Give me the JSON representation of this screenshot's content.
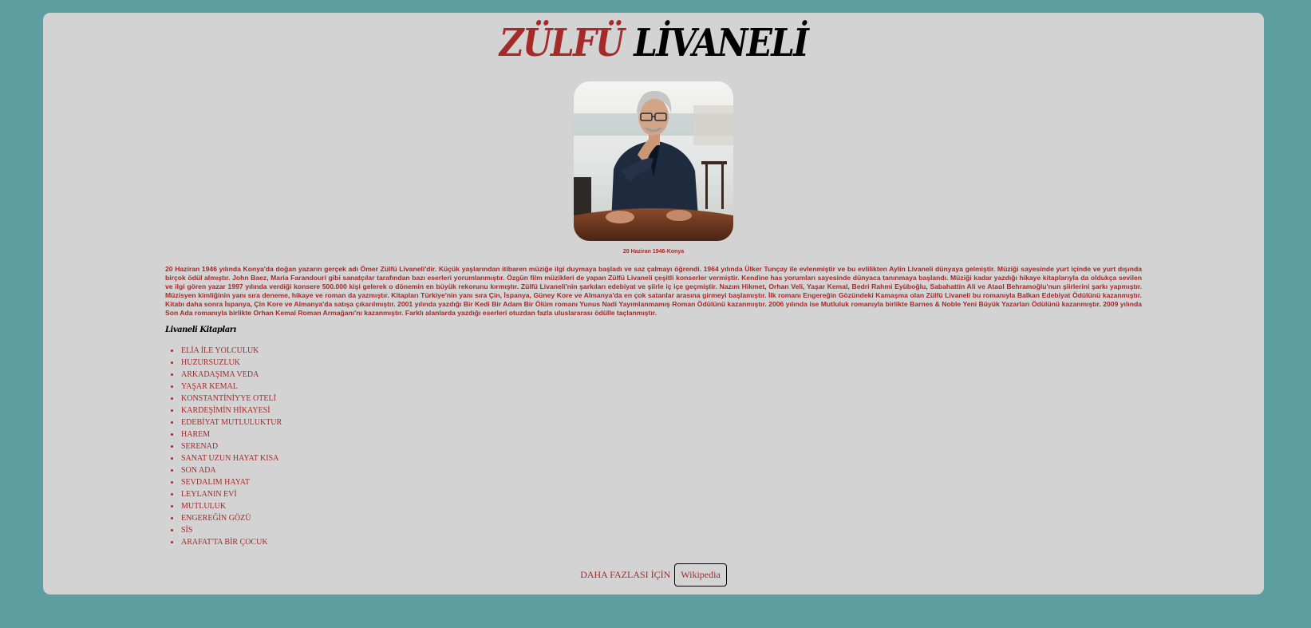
{
  "header": {
    "first_name": "ZÜLFÜ",
    "last_name": "LİVANELİ"
  },
  "portrait": {
    "caption": "20 Haziran 1946-Konya"
  },
  "bio": {
    "text": "20 Haziran 1946 yılında Konya'da doğan yazarın gerçek adı Ömer Zülfü Livaneli'dir. Küçük yaşlarından itibaren müziğe ilgi duymaya başladı ve saz çalmayı öğrendi. 1964 yılında Ülker Tunçay ile evlenmiştir ve bu evlilikten Aylin Livaneli dünyaya gelmiştir. Müziği sayesinde yurt içinde ve yurt dışında birçok ödül almıştır. John Baez, Maria Farandouri gibi sanatçılar tarafından bazı eserleri yorumlanmıştır. Özgün film müzikleri de yapan Zülfü Livaneli çeşitli konserler vermiştir. Kendine has yorumları sayesinde dünyaca tanınmaya başlandı. Müziği kadar yazdığı hikaye kitaplarıyla da oldukça sevilen ve ilgi gören yazar 1997 yılında verdiği konsere 500.000 kişi gelerek o dönemin en büyük rekorunu kırmıştır. Zülfü Livaneli'nin şarkıları edebiyat ve şiirle iç içe geçmiştir. Nazım Hikmet, Orhan Veli, Yaşar Kemal, Bedri Rahmi Eyüboğlu, Sabahattin Ali ve Ataol Behramoğlu'nun şiirlerini şarkı yapmıştır. Müzisyen kimliğinin yanı sıra deneme, hikaye ve roman da yazmıştır. Kitapları Türkiye'nin yanı sıra Çin, İspanya, Güney Kore ve Almanya'da en çok satanlar arasına girmeyi başlamıştır. İlk romanı Engereğin Gözündeki Kamaşma olan Zülfü Livaneli bu romanıyla Balkan Edebiyat Ödülünü kazanmıştır. Kitabı daha sonra İspanya, Çin Kore ve Almanya'da satışa çıkarılmıştır. 2001 yılında yazdığı Bir Kedi Bir Adam Bir Ölüm romanı Yunus Nadi Yayımlanmamış Roman Ödülünü kazanmıştır. 2006 yılında ise Mutluluk romanıyla birlikte Barnes & Noble Yeni Büyük Yazarları Ödülünü kazanmıştır. 2009 yılında Son Ada romanıyla birlikte Orhan Kemal Roman Armağanı'nı kazanmıştır. Farklı alanlarda yazdığı eserleri otuzdan fazla uluslararası ödülle taçlanmıştır."
  },
  "books": {
    "heading": "Livaneli Kitapları",
    "items": [
      "ELİA İLE YOLCULUK",
      "HUZURSUZLUK",
      "ARKADAŞIMA VEDA",
      "YAŞAR KEMAL",
      "KONSTANTİNİYYE OTELİ",
      "KARDEŞİMİN HİKAYESİ",
      "EDEBİYAT MUTLULUKTUR",
      "HAREM",
      "SERENAD",
      "SANAT UZUN HAYAT KISA",
      "SON ADA",
      "SEVDALIM HAYAT",
      "LEYLANIN EVİ",
      "MUTLULUK",
      "ENGEREĞİN GÖZÜ",
      "SİS",
      "ARAFAT'TA BİR ÇOCUK"
    ]
  },
  "footer": {
    "more_text": "DAHA FAZLASI İÇİN",
    "button_label": "Wikipedia"
  },
  "colors": {
    "page_background": "#5f9ea0",
    "card_background": "#d3d3d3",
    "accent": "#a52a2a",
    "title_last_name": "#000000"
  }
}
